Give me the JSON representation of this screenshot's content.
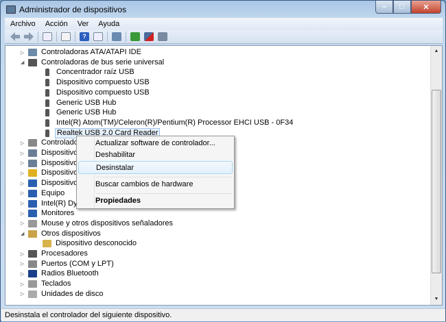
{
  "window": {
    "title": "Administrador de dispositivos",
    "minimize": "–",
    "maximize": "□",
    "close": "✕"
  },
  "menu": [
    "Archivo",
    "Acción",
    "Ver",
    "Ayuda"
  ],
  "toolbar": [
    "back",
    "forward",
    "show-hide-tree",
    "properties",
    "help",
    "action-pane",
    "scan-hardware",
    "update-driver",
    "uninstall",
    "disable"
  ],
  "tree": [
    {
      "label": "Controladoras ATA/ATAPI IDE",
      "level": 0,
      "exp": "▷",
      "icon": "#6d8aa8"
    },
    {
      "label": "Controladoras de bus serie universal",
      "level": 0,
      "exp": "◢",
      "icon": "#555"
    },
    {
      "label": "Concentrador raíz USB",
      "level": 1,
      "icon": "#555"
    },
    {
      "label": "Dispositivo compuesto USB",
      "level": 1,
      "icon": "#555"
    },
    {
      "label": "Dispositivo compuesto USB",
      "level": 1,
      "icon": "#555"
    },
    {
      "label": "Generic USB Hub",
      "level": 1,
      "icon": "#555"
    },
    {
      "label": "Generic USB Hub",
      "level": 1,
      "icon": "#555"
    },
    {
      "label": "Intel(R) Atom(TM)/Celeron(R)/Pentium(R) Processor EHCI USB - 0F34",
      "level": 1,
      "icon": "#555"
    },
    {
      "label": "Realtek USB 2.0 Card Reader",
      "level": 1,
      "icon": "#555",
      "selected": true
    },
    {
      "label": "Controladoras de sonido y vídeo y dispositivos de juego",
      "level": 0,
      "exp": "▷",
      "icon": "#888"
    },
    {
      "label": "Dispositivos de imagen",
      "level": 0,
      "exp": "▷",
      "icon": "#6a7f96"
    },
    {
      "label": "Dispositivos de interfaz humana",
      "level": 0,
      "exp": "▷",
      "icon": "#6a7f96"
    },
    {
      "label": "Dispositivos de seguridad",
      "level": 0,
      "exp": "▷",
      "icon": "#e0b020"
    },
    {
      "label": "Dispositivos del sistema",
      "level": 0,
      "exp": "▷",
      "icon": "#2a5fb0"
    },
    {
      "label": "Equipo",
      "level": 0,
      "exp": "▷",
      "icon": "#2a5fb0"
    },
    {
      "label": "Intel(R) Dynamic Platform and Thermal Framework",
      "level": 0,
      "exp": "▷",
      "icon": "#2a5fb0"
    },
    {
      "label": "Monitores",
      "level": 0,
      "exp": "▷",
      "icon": "#2a5fb0"
    },
    {
      "label": "Mouse y otros dispositivos señaladores",
      "level": 0,
      "exp": "▷",
      "icon": "#999"
    },
    {
      "label": "Otros dispositivos",
      "level": 0,
      "exp": "◢",
      "icon": "#c9a24a"
    },
    {
      "label": "Dispositivo desconocido",
      "level": 1,
      "icon": "#d8b24a"
    },
    {
      "label": "Procesadores",
      "level": 0,
      "exp": "▷",
      "icon": "#555"
    },
    {
      "label": "Puertos (COM y LPT)",
      "level": 0,
      "exp": "▷",
      "icon": "#888"
    },
    {
      "label": "Radios Bluetooth",
      "level": 0,
      "exp": "▷",
      "icon": "#1a3f8a"
    },
    {
      "label": "Teclados",
      "level": 0,
      "exp": "▷",
      "icon": "#999"
    },
    {
      "label": "Unidades de disco",
      "level": 0,
      "exp": "▷",
      "icon": "#aaa"
    }
  ],
  "context_menu": {
    "update": "Actualizar software de controlador...",
    "disable": "Deshabilitar",
    "uninstall": "Desinstalar",
    "scan": "Buscar cambios de hardware",
    "properties": "Propiedades"
  },
  "status": "Desinstala el controlador del siguiente dispositivo."
}
